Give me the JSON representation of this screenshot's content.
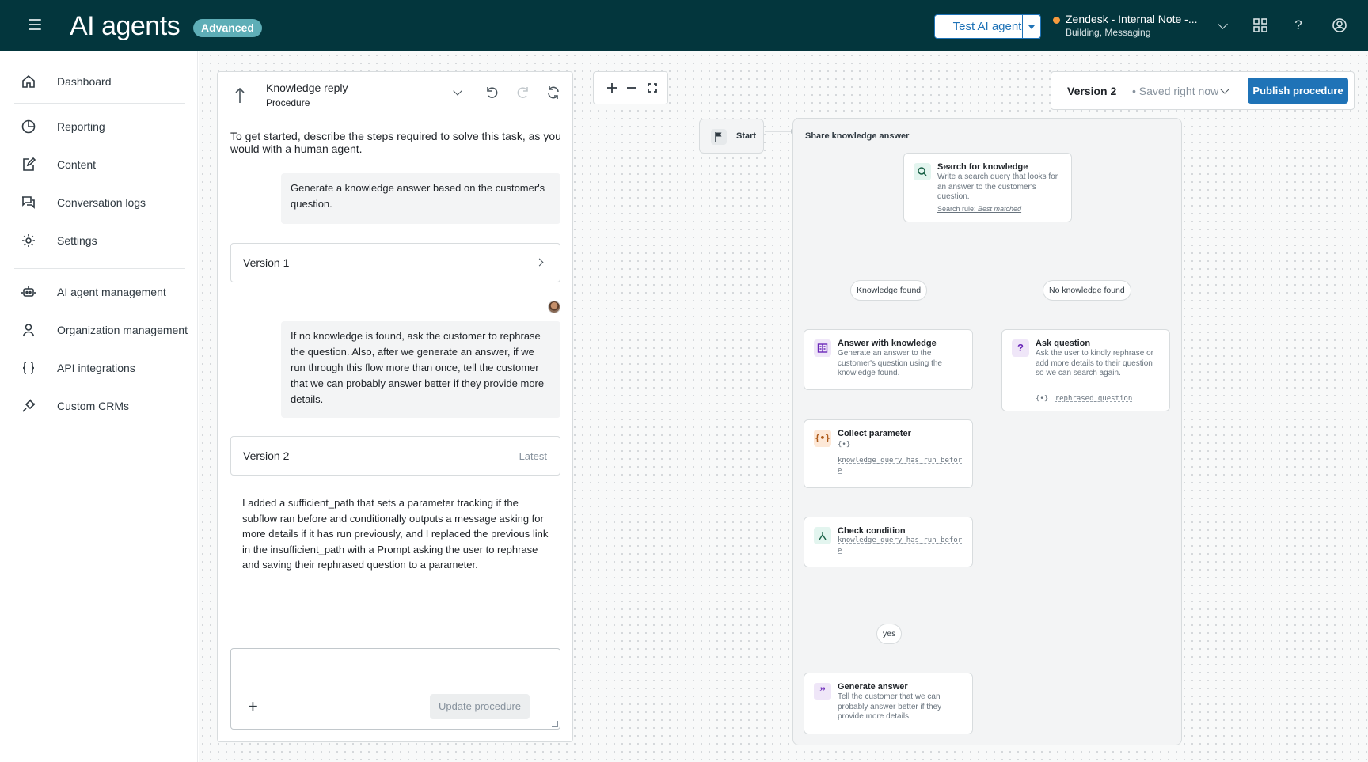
{
  "header": {
    "title": "AI agents",
    "badge": "Advanced",
    "test_button": "Test AI agent",
    "channel_name": "Zendesk - Internal Note -...",
    "channel_sub": "Building, Messaging",
    "help_glyph": "?"
  },
  "sidebar": {
    "items": [
      {
        "label": "Dashboard",
        "icon": "home-icon"
      },
      {
        "label": "Reporting",
        "icon": "pie-chart-icon"
      },
      {
        "label": "Content",
        "icon": "edit-icon"
      },
      {
        "label": "Conversation logs",
        "icon": "chat-bubbles-icon"
      },
      {
        "label": "Settings",
        "icon": "gear-icon"
      },
      {
        "label": "AI agent management",
        "icon": "robot-icon"
      },
      {
        "label": "Organization management",
        "icon": "user-icon"
      },
      {
        "label": "API integrations",
        "icon": "braces-icon"
      },
      {
        "label": "Custom CRMs",
        "icon": "plug-icon"
      }
    ]
  },
  "panel": {
    "title": "Knowledge reply",
    "subtitle": "Procedure",
    "intro": "To get started, describe the steps required to solve this task, as you would with a human agent.",
    "message_1": "Generate a knowledge answer based on the customer's question.",
    "version_1": "Version 1",
    "message_2": "If no knowledge is found, ask the customer to rephrase the question. Also, after we generate an answer, if we run through this flow more than once, tell the customer that we can probably answer better if they provide more details.",
    "version_2": "Version 2",
    "version_2_tag": "Latest",
    "ai_response": "I added a sufficient_path that sets a parameter tracking if the subflow ran before and conditionally outputs a message asking for more details if it has run previously, and I replaced the previous link in the insufficient_path with a Prompt asking the user to rephrase and saving their rephrased question to a parameter.",
    "composer_plus": "+",
    "update_button": "Update procedure"
  },
  "toolbar": {
    "version_current": "Version 2",
    "version_saved": "• Saved right now",
    "publish_button": "Publish procedure"
  },
  "flow": {
    "start_label": "Start",
    "group_title": "Share knowledge answer",
    "search": {
      "title": "Search for knowledge",
      "desc": "Write a search query that looks for an answer to the customer's question.",
      "rule_prefix": "Search rule: ",
      "rule_value": "Best matched"
    },
    "branch_found": "Knowledge found",
    "branch_not_found": "No knowledge found",
    "answer": {
      "title": "Answer with knowledge",
      "desc": "Generate an answer to the customer's question using the knowledge found."
    },
    "ask": {
      "title": "Ask question",
      "desc": "Ask the user to kindly rephrase or add more details to their question so we can search again.",
      "param_icon": "{•}",
      "param": "rephrased_question"
    },
    "collect": {
      "title": "Collect parameter",
      "param_icon": "{•}",
      "param": "knowledge_query_has_run_before"
    },
    "check": {
      "title": "Check condition",
      "param": "knowledge_query_has_run_before"
    },
    "yes_label": "yes",
    "generate": {
      "title": "Generate answer",
      "desc": "Tell the customer that we can probably answer better if they provide more details."
    }
  },
  "colors": {
    "header_bg": "#03363d",
    "accent_blue": "#1f73b7",
    "badge_bg": "#5eaeb7",
    "status_dot": "#f79a3e"
  }
}
